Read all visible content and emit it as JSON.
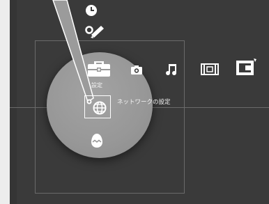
{
  "menu": {
    "settings_label": "設定",
    "selected_item_label": "ネットワークの設定"
  },
  "categories": [
    {
      "name": "settings",
      "icon": "toolbox-icon"
    },
    {
      "name": "photo",
      "icon": "camera-icon"
    },
    {
      "name": "music",
      "icon": "music-note-icon"
    },
    {
      "name": "video",
      "icon": "film-strip-icon"
    },
    {
      "name": "game",
      "icon": "game-icon"
    }
  ],
  "colors": {
    "background": "#3a3a3a",
    "magnifier": "#999999",
    "icon": "#ffffff",
    "guide_lines": "#6a6a6a"
  }
}
